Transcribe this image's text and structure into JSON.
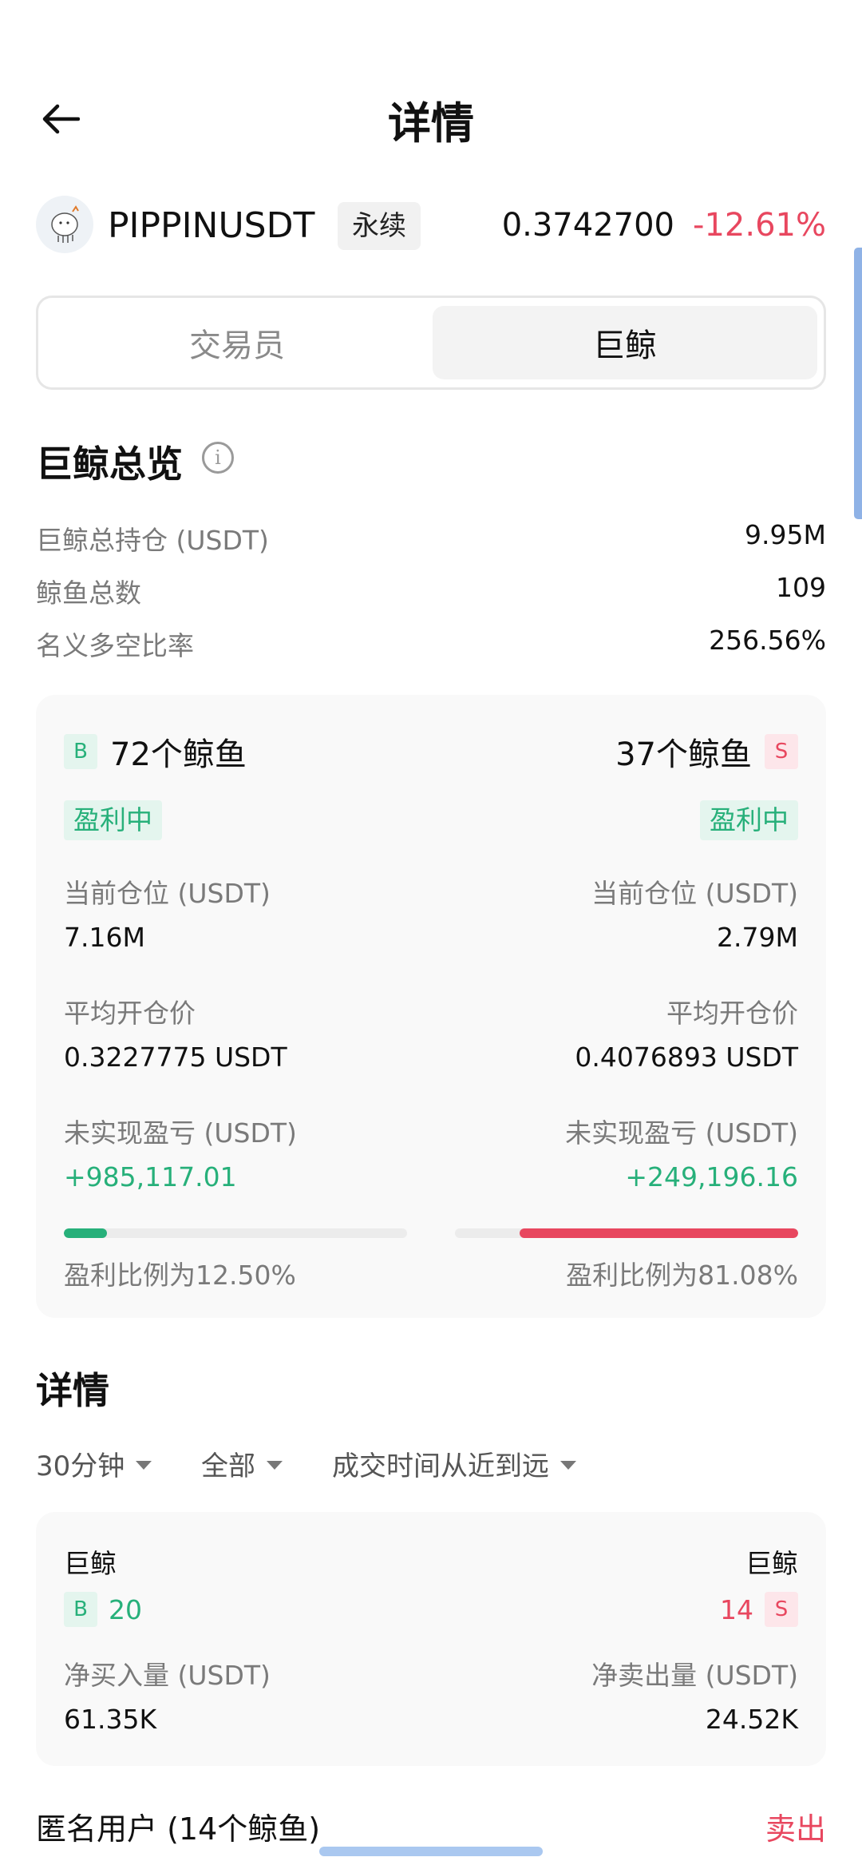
{
  "header": {
    "title": "详情"
  },
  "symbol": {
    "name": "PIPPINUSDT",
    "tag": "永续",
    "price": "0.3742700",
    "change": "-12.61%",
    "change_color": "#e8475f"
  },
  "tabs": [
    {
      "label": "交易员",
      "selected": false
    },
    {
      "label": "巨鲸",
      "selected": true
    }
  ],
  "overview": {
    "title": "巨鲸总览",
    "rows": [
      {
        "label": "巨鲸总持仓 (USDT)",
        "value": "9.95M"
      },
      {
        "label": "鲸鱼总数",
        "value": "109"
      },
      {
        "label": "名义多空比率",
        "value": "256.56%"
      }
    ]
  },
  "long_short": {
    "long": {
      "badge": "B",
      "count_label": "72个鲸鱼",
      "status": "盈利中",
      "position_label": "当前仓位 (USDT)",
      "position_value": "7.16M",
      "avg_price_label": "平均开仓价",
      "avg_price_value": "0.3227775 USDT",
      "pnl_label": "未实现盈亏 (USDT)",
      "pnl_value": "+985,117.01",
      "profit_ratio_label": "盈利比例为12.50%",
      "profit_ratio": 0.125
    },
    "short": {
      "badge": "S",
      "count_label": "37个鲸鱼",
      "status": "盈利中",
      "position_label": "当前仓位 (USDT)",
      "position_value": "2.79M",
      "avg_price_label": "平均开仓价",
      "avg_price_value": "0.4076893 USDT",
      "pnl_label": "未实现盈亏 (USDT)",
      "pnl_value": "+249,196.16",
      "profit_ratio_label": "盈利比例为81.08%",
      "profit_ratio": 0.8108
    }
  },
  "details": {
    "title": "详情",
    "filters": [
      {
        "label": "30分钟"
      },
      {
        "label": "全部"
      },
      {
        "label": "成交时间从近到远"
      }
    ],
    "card": {
      "left_title": "巨鲸",
      "left_badge": "B",
      "left_count": "20",
      "right_title": "巨鲸",
      "right_badge": "S",
      "right_count": "14",
      "net_buy_label": "净买入量 (USDT)",
      "net_buy_value": "61.35K",
      "net_sell_label": "净卖出量 (USDT)",
      "net_sell_value": "24.52K"
    }
  },
  "bottom": {
    "user_label": "匿名用户 (14个鲸鱼)",
    "action_label": "卖出"
  },
  "colors": {
    "green": "#27b07a",
    "red": "#e8475f",
    "gray_text": "#7a7a7a"
  }
}
